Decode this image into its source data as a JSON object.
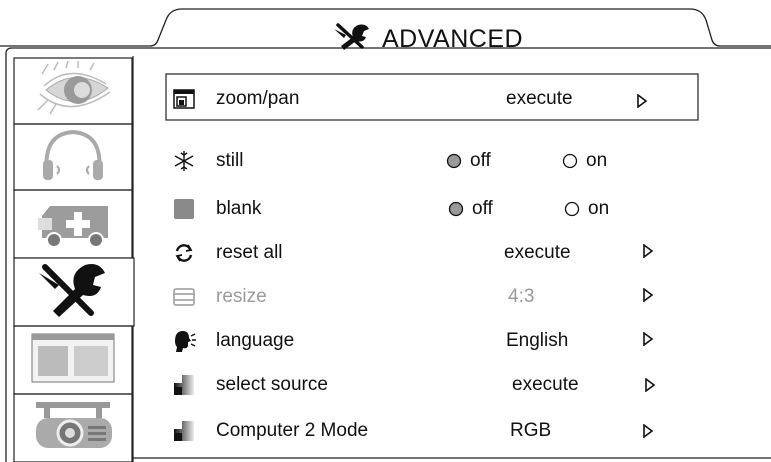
{
  "header": {
    "title": "ADVANCED",
    "title_icon": "tools-icon"
  },
  "tabs": [
    {
      "name": "picture",
      "icon": "eye-icon"
    },
    {
      "name": "audio",
      "icon": "headphones-icon"
    },
    {
      "name": "setup",
      "icon": "ambulance-icon"
    },
    {
      "name": "advanced",
      "icon": "tools-icon",
      "selected": true
    },
    {
      "name": "layout",
      "icon": "window-layout-icon"
    },
    {
      "name": "projector",
      "icon": "projector-icon"
    }
  ],
  "menu": {
    "zoom": {
      "label": "zoom/pan",
      "value": "execute",
      "icon": "zoom-pan-icon"
    },
    "still": {
      "label": "still",
      "icon": "snowflake-icon",
      "opt_off": "off",
      "opt_on": "on",
      "selected": "off"
    },
    "blank": {
      "label": "blank",
      "icon": "blank-square-icon",
      "opt_off": "off",
      "opt_on": "on",
      "selected": "off"
    },
    "reset": {
      "label": "reset all",
      "value": "execute",
      "icon": "reset-icon"
    },
    "resize": {
      "label": "resize",
      "value": "4:3",
      "icon": "resize-icon",
      "disabled": true
    },
    "language": {
      "label": "language",
      "value": "English",
      "icon": "language-icon"
    },
    "source": {
      "label": "select source",
      "value": "execute",
      "icon": "source-icon"
    },
    "comp2": {
      "label": "Computer 2 Mode",
      "value": "RGB",
      "icon": "source-icon"
    }
  }
}
